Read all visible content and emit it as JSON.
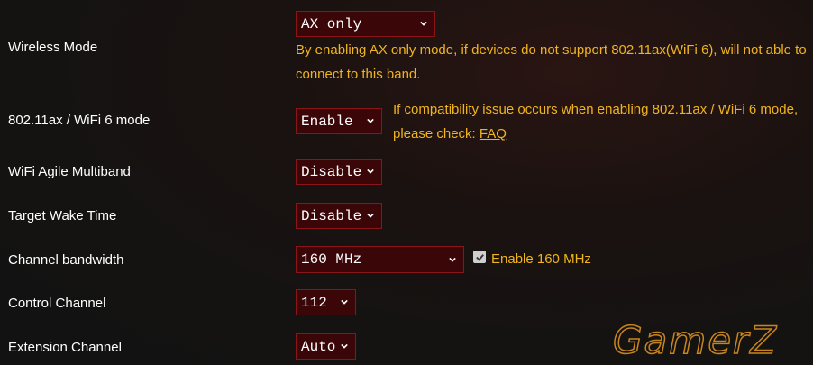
{
  "rows": [
    {
      "label": "Wireless Mode",
      "value": "AX only",
      "note_line1": "By enabling AX only mode, if devices do not support 802.11ax(WiFi 6), will not able to",
      "note_line2": "connect to this band."
    },
    {
      "label": "802.11ax / WiFi 6 mode",
      "value": "Enable",
      "note_line1": "If compatibility issue occurs when enabling 802.11ax / WiFi 6 mode,",
      "note_line2_prefix": "please check: ",
      "note_link": "FAQ"
    },
    {
      "label": "WiFi Agile Multiband",
      "value": "Disable"
    },
    {
      "label": "Target Wake Time",
      "value": "Disable"
    },
    {
      "label": "Channel bandwidth",
      "value": "160 MHz",
      "checkbox_label": "Enable 160 MHz",
      "checkbox_checked": true
    },
    {
      "label": "Control Channel",
      "value": "112"
    },
    {
      "label": "Extension Channel",
      "value": "Auto"
    }
  ],
  "watermark": "GamerZ",
  "colors": {
    "accent": "#f0b41e",
    "select_bg": "#3a0608",
    "select_border": "#8a1519"
  }
}
